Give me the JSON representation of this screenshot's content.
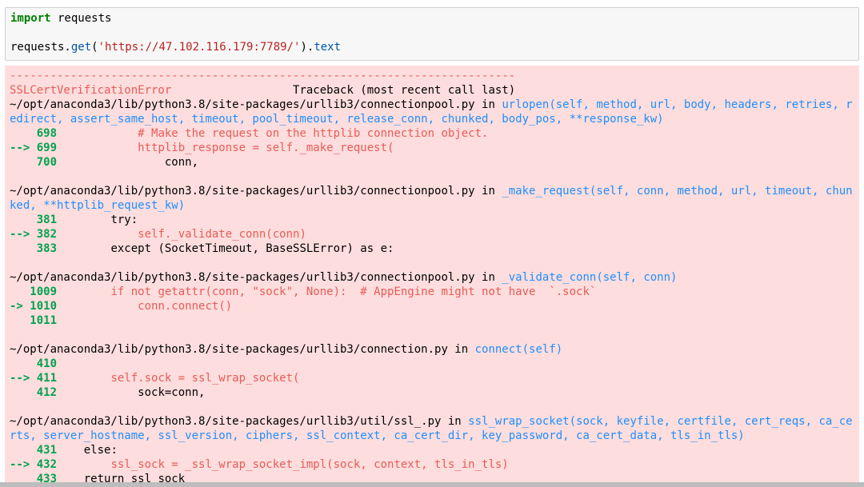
{
  "input_cell": {
    "line1": {
      "keyword": "import",
      "rest": " requests"
    },
    "line2": {
      "prefix": "requests.",
      "func": "get",
      "open": "(",
      "str": "'https://47.102.116.179:7789/'",
      "close": ").",
      "attr": "text"
    }
  },
  "output": {
    "dashes": "---------------------------------------------------------------------------",
    "error_name": "SSLCertVerificationError",
    "traceback_header": "                  Traceback (most recent call last)",
    "frames": [
      {
        "path": "~/opt/anaconda3/lib/python3.8/site-packages/urllib3/connectionpool.py",
        "in": " in ",
        "sig_line1": "urlopen(self, method, url, body, headers, retries, r",
        "sig_line2": "edirect, assert_same_host, timeout, pool_timeout, release_conn, chunked, body_pos, **response_kw)",
        "lines": [
          {
            "arrow": "    ",
            "num": "698",
            "code": "            # Make the request on the httplib connection object."
          },
          {
            "arrow": "--> ",
            "num": "699",
            "code": "            httplib_response = self._make_request("
          },
          {
            "arrow": "    ",
            "num": "700",
            "code": "                conn,"
          }
        ]
      },
      {
        "path": "~/opt/anaconda3/lib/python3.8/site-packages/urllib3/connectionpool.py",
        "in": " in ",
        "sig_line1": "_make_request(self, conn, method, url, timeout, chun",
        "sig_line2": "ked, **httplib_request_kw)",
        "lines": [
          {
            "arrow": "    ",
            "num": "381",
            "code": "        try:"
          },
          {
            "arrow": "--> ",
            "num": "382",
            "code": "            self._validate_conn(conn)"
          },
          {
            "arrow": "    ",
            "num": "383",
            "code": "        except (SocketTimeout, BaseSSLError) as e:"
          }
        ]
      },
      {
        "path": "~/opt/anaconda3/lib/python3.8/site-packages/urllib3/connectionpool.py",
        "in": " in ",
        "sig_line1": "_validate_conn(self, conn)",
        "lines": [
          {
            "arrow": "   ",
            "num": "1009",
            "code": "        if not getattr(conn, \"sock\", None):  # AppEngine might not have  `.sock`"
          },
          {
            "arrow": "-> ",
            "num": "1010",
            "code": "            conn.connect()"
          },
          {
            "arrow": "   ",
            "num": "1011",
            "code": ""
          }
        ]
      },
      {
        "path": "~/opt/anaconda3/lib/python3.8/site-packages/urllib3/connection.py",
        "in": " in ",
        "sig_line1": "connect(self)",
        "lines": [
          {
            "arrow": "    ",
            "num": "410",
            "code": ""
          },
          {
            "arrow": "--> ",
            "num": "411",
            "code": "        self.sock = ssl_wrap_socket("
          },
          {
            "arrow": "    ",
            "num": "412",
            "code": "            sock=conn,"
          }
        ]
      },
      {
        "path": "~/opt/anaconda3/lib/python3.8/site-packages/urllib3/util/ssl_.py",
        "in": " in ",
        "sig_line1": "ssl_wrap_socket(sock, keyfile, certfile, cert_reqs, ca_ce",
        "sig_line2": "rts, server_hostname, ssl_version, ciphers, ssl_context, ca_cert_dir, key_password, ca_cert_data, tls_in_tls)",
        "lines": [
          {
            "arrow": "    ",
            "num": "431",
            "code": "    else:"
          },
          {
            "arrow": "--> ",
            "num": "432",
            "code": "        ssl_sock = _ssl_wrap_socket_impl(sock, context, tls_in_tls)"
          },
          {
            "arrow": "    ",
            "num": "433",
            "code": "    return ssl_sock"
          }
        ]
      }
    ]
  }
}
